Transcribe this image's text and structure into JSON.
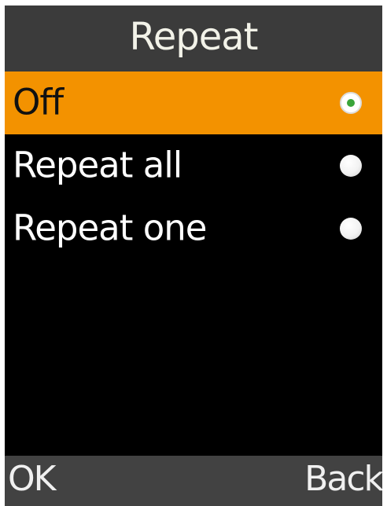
{
  "header": {
    "title": "Repeat"
  },
  "options": [
    {
      "label": "Off",
      "selected": true
    },
    {
      "label": "Repeat all",
      "selected": false
    },
    {
      "label": "Repeat one",
      "selected": false
    }
  ],
  "softkeys": {
    "left_label": "OK",
    "right_label": "Back"
  },
  "colors": {
    "highlight": "#f39200",
    "title_bar": "#3b3b3b",
    "softkey_bar": "#424242",
    "background": "#000000",
    "radio_selected_dot": "#3aa53a"
  }
}
